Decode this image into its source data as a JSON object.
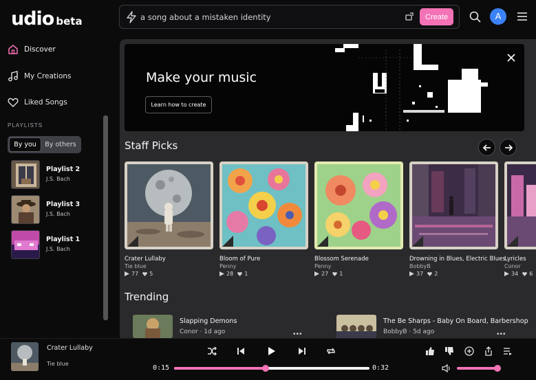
{
  "header": {
    "logo": "udio",
    "logo_badge": "beta",
    "prompt_value": "a song about a mistaken identity",
    "create_label": "Create",
    "avatar_letter": "A"
  },
  "sidebar": {
    "items": [
      {
        "label": "Discover"
      },
      {
        "label": "My Creations"
      },
      {
        "label": "Liked Songs"
      }
    ],
    "playlists_label": "PLAYLISTS",
    "filter": {
      "by_you": "By you",
      "by_others": "By others"
    },
    "playlists": [
      {
        "title": "Playlist 2",
        "author": "J.S. Bach"
      },
      {
        "title": "Playlist 3",
        "author": "J.S. Bach"
      },
      {
        "title": "Playlist 1",
        "author": "J.S. Bach"
      }
    ]
  },
  "hero": {
    "title": "Make your music",
    "button_label": "Learn how to create"
  },
  "staff_picks": {
    "title": "Staff Picks",
    "cards": [
      {
        "title": "Crater Lullaby",
        "artist": "Tie blue",
        "plays": "77",
        "likes": "5"
      },
      {
        "title": "Bloom of Pure",
        "artist": "Penny",
        "plays": "28",
        "likes": "1"
      },
      {
        "title": "Blossom Serenade",
        "artist": "Penny",
        "plays": "27",
        "likes": "1"
      },
      {
        "title": "Drowning in Blues, Electric Blues",
        "artist": "BobbyB",
        "plays": "37",
        "likes": "2"
      },
      {
        "title": "Lyricles",
        "artist": "Conor",
        "plays": "34",
        "likes": "6"
      }
    ]
  },
  "trending": {
    "title": "Trending",
    "items": [
      {
        "title": "Slapping Demons",
        "meta": "Conor · 1d ago"
      },
      {
        "title": "The Be Sharps - Baby On Board, Barbershop",
        "meta": "BobbyB · 5d ago"
      }
    ]
  },
  "player": {
    "title": "Crater Lullaby",
    "artist": "Tie blue",
    "elapsed": "0:15",
    "duration": "0:32",
    "progress_fraction": 0.47,
    "volume_fraction": 1.0
  },
  "colors": {
    "accent": "#f472b6",
    "avatar": "#3b82f6",
    "panel": "#2a2a2d",
    "background": "#0b0b0c"
  }
}
